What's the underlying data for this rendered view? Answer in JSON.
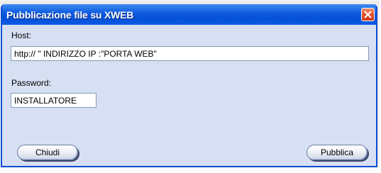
{
  "window": {
    "title": "Pubblicazione file su XWEB",
    "close_icon": "close-x-icon"
  },
  "form": {
    "host_label": "Host:",
    "host_value": "http:// \" INDIRIZZO IP :\"PORTA WEB\"",
    "password_label": "Password:",
    "password_value": "INSTALLATORE"
  },
  "buttons": {
    "close_label": "Chiudi",
    "publish_label": "Pubblica"
  },
  "colors": {
    "titlebar": "#0650d6",
    "dialog_background": "#d7dff3",
    "close_button": "#dc4a26"
  }
}
